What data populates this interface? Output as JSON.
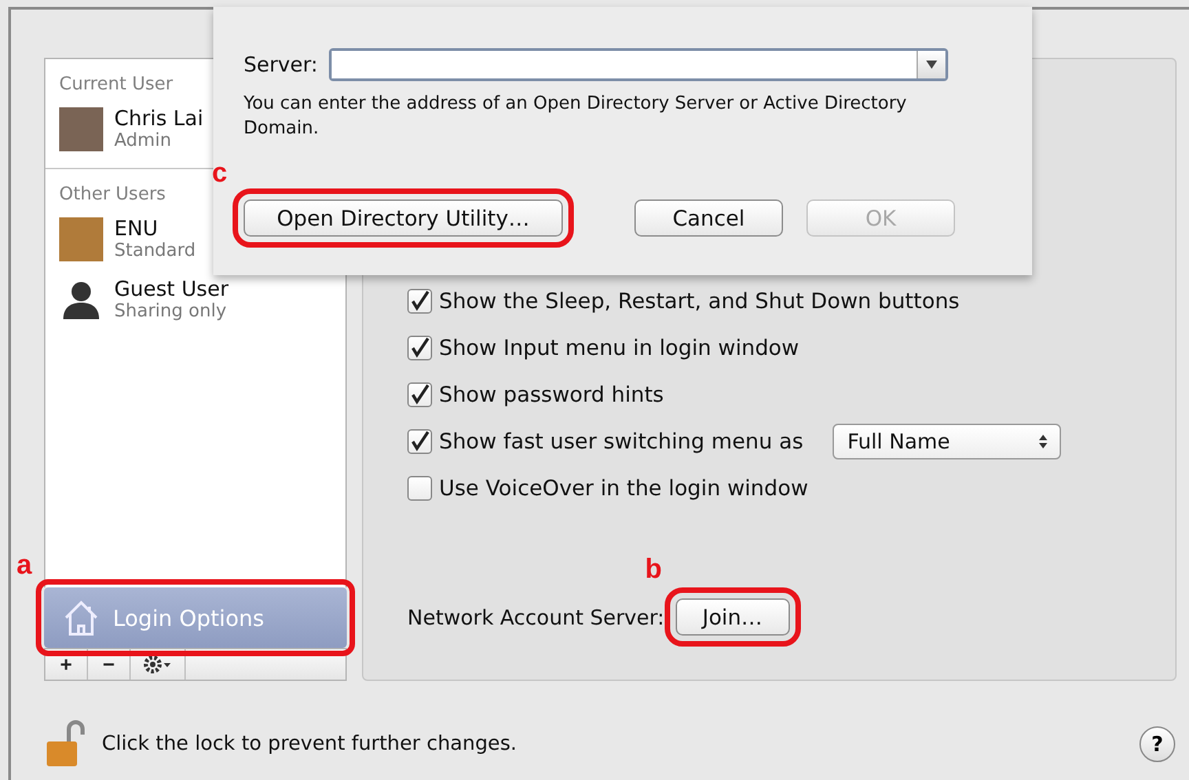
{
  "sidebar": {
    "sections": [
      {
        "heading": "Current User",
        "users": [
          {
            "name": "Chris Lai",
            "role": "Admin",
            "kind": "photo"
          }
        ]
      },
      {
        "heading": "Other Users",
        "users": [
          {
            "name": "ENU",
            "role": "Standard",
            "kind": "photo"
          },
          {
            "name": "Guest User",
            "role": "Sharing only",
            "kind": "silhouette"
          }
        ]
      }
    ],
    "login_options": {
      "label": "Login Options",
      "selected": true,
      "callout": "a"
    },
    "toolbar": [
      "+",
      "−"
    ]
  },
  "options": [
    {
      "label": "Show the Sleep, Restart, and Shut Down buttons",
      "checked": true
    },
    {
      "label": "Show Input menu in login window",
      "checked": true
    },
    {
      "label": "Show password hints",
      "checked": true
    },
    {
      "label": "Show fast user switching menu as",
      "checked": true,
      "select": "Full Name"
    },
    {
      "label": "Use VoiceOver in the login window",
      "checked": false
    }
  ],
  "network": {
    "label": "Network Account Server:",
    "button": {
      "label": "Join…",
      "callout": "b"
    }
  },
  "sheet": {
    "server_label": "Server:",
    "hint": "You can enter the address of an Open Directory Server or Active Directory Domain.",
    "buttons": [
      {
        "label": "Open Directory Utility…",
        "disabled": false,
        "callout": "c"
      },
      {
        "label": "Cancel",
        "disabled": false
      },
      {
        "label": "OK",
        "disabled": true
      }
    ]
  },
  "footer": {
    "lock_text": "Click the lock to prevent further changes.",
    "help": "?"
  }
}
